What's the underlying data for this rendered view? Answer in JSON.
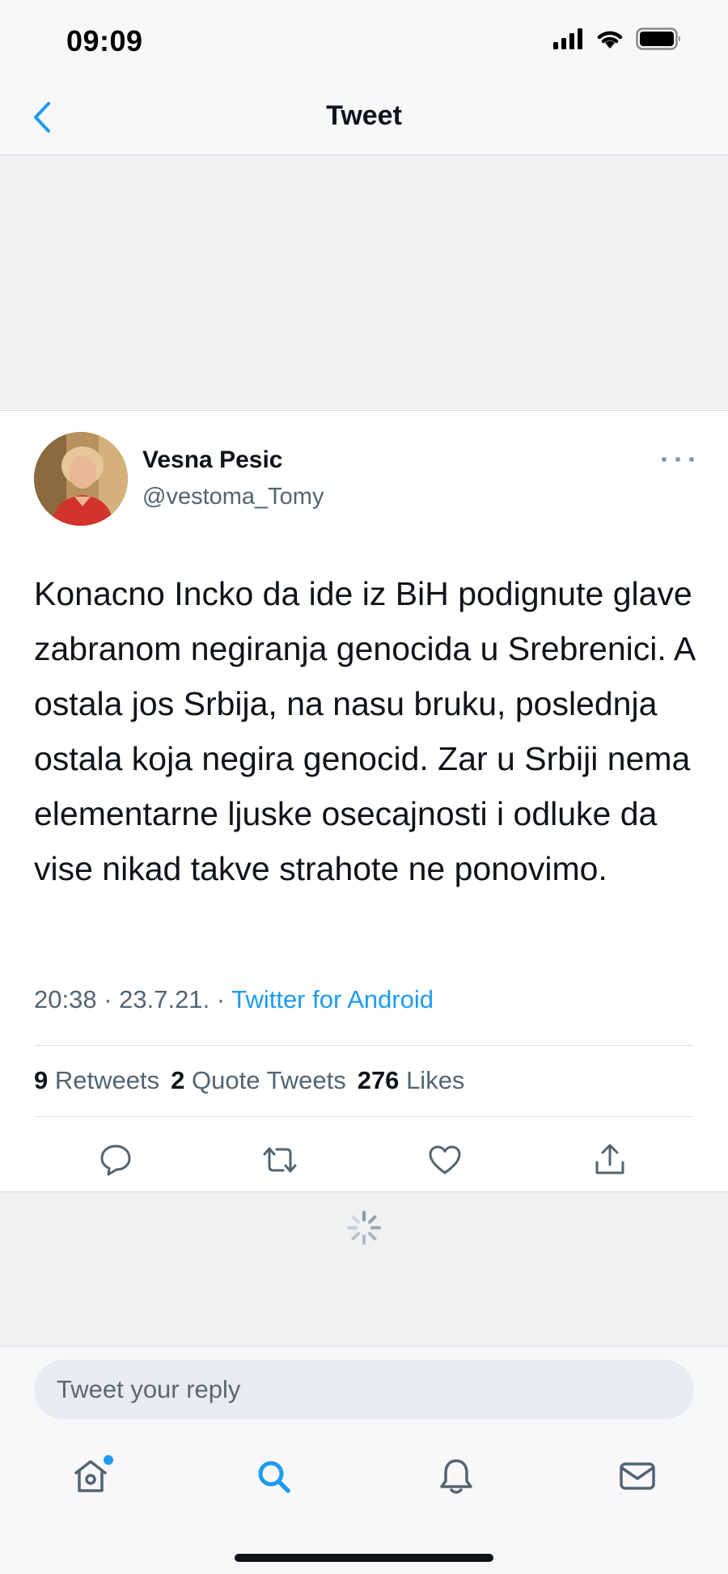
{
  "status_bar": {
    "time": "09:09"
  },
  "nav": {
    "title": "Tweet"
  },
  "tweet": {
    "author_name": "Vesna Pesic",
    "author_handle": "@vestoma_Tomy",
    "text": "Konacno Incko da ide iz BiH podignute glave zabranom negiranja genocida u Srebrenici. A ostala jos Srbija,  na nasu bruku, poslednja ostala koja negira genocid. Zar u Srbiji nema elementarne ljuske osecajnosti i odluke da vise nikad takve strahote ne ponovimo.",
    "time": "20:38",
    "date": "23.7.21.",
    "separator": "·",
    "source": "Twitter for Android",
    "stats": {
      "retweets_count": "9",
      "retweets_label": "Retweets",
      "quotes_count": "2",
      "quotes_label": "Quote Tweets",
      "likes_count": "276",
      "likes_label": "Likes"
    }
  },
  "reply": {
    "placeholder": "Tweet your reply"
  },
  "icons": {
    "back": "chevron-left-icon",
    "more": "more-horizontal-icon",
    "reply": "comment-icon",
    "retweet": "retweet-icon",
    "like": "heart-icon",
    "share": "share-icon",
    "home": "home-icon",
    "search": "search-icon",
    "notifications": "bell-icon",
    "messages": "mail-icon"
  },
  "colors": {
    "accent": "#1d9bf0",
    "text": "#0f1419",
    "secondary": "#536471"
  }
}
